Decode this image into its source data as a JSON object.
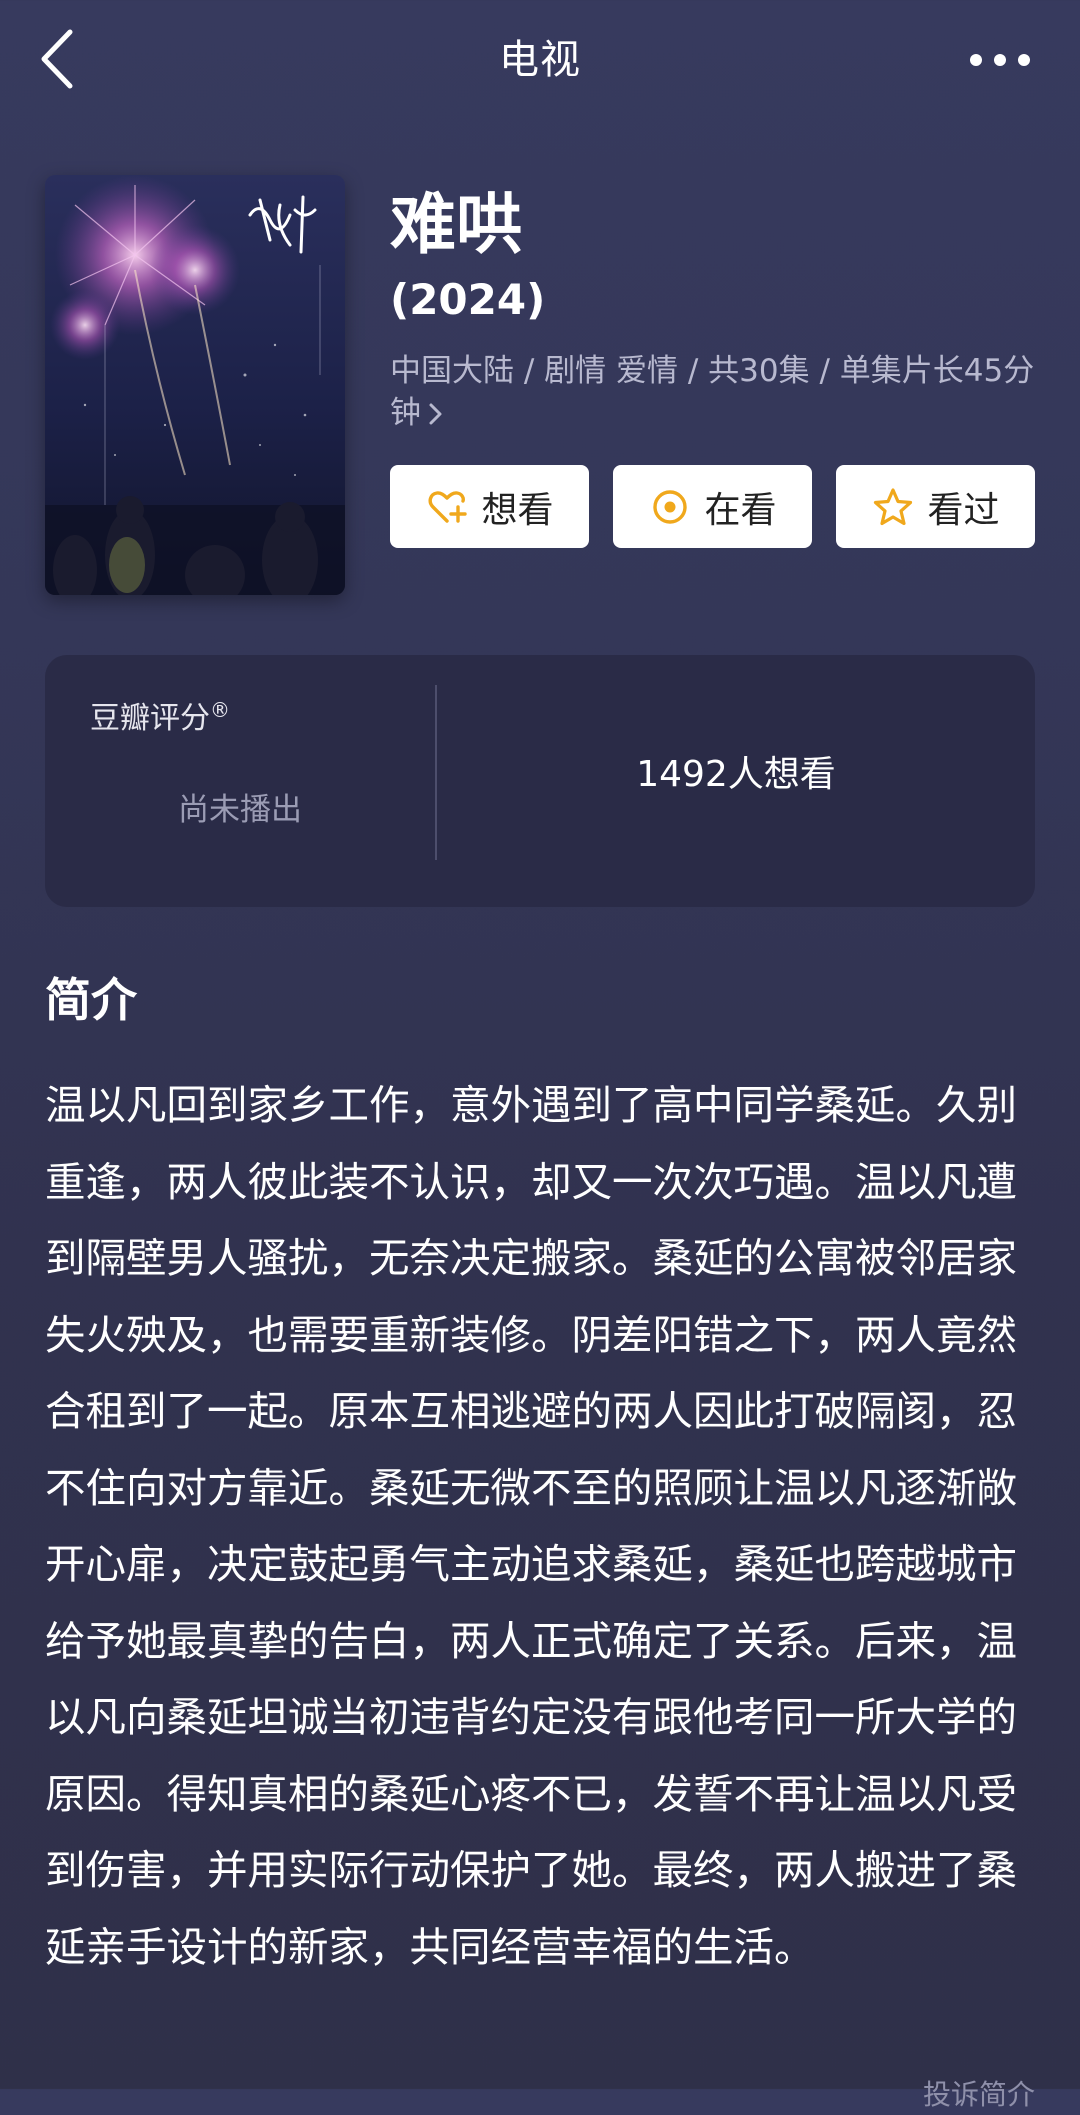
{
  "header": {
    "title": "电视",
    "back_icon": "chevron-left-icon",
    "more_icon": "more-horizontal-icon"
  },
  "movie": {
    "title": "难哄",
    "year": "(2024)",
    "meta": "中国大陆 / 剧情 爱情 / 共30集 / 单集片长45分钟",
    "poster_logo": "难哄"
  },
  "actions": {
    "want": {
      "label": "想看",
      "icon": "heart-plus-icon"
    },
    "watching": {
      "label": "在看",
      "icon": "circle-dot-icon"
    },
    "watched": {
      "label": "看过",
      "icon": "star-icon"
    }
  },
  "rating": {
    "label": "豆瓣评分",
    "trademark": "®",
    "status": "尚未播出",
    "want_count": "1492人想看"
  },
  "intro": {
    "heading": "简介",
    "body": "温以凡回到家乡工作，意外遇到了高中同学桑延。久别重逢，两人彼此装不认识，却又一次次巧遇。温以凡遭到隔壁男人骚扰，无奈决定搬家。桑延的公寓被邻居家失火殃及，也需要重新装修。阴差阳错之下，两人竟然合租到了一起。原本互相逃避的两人因此打破隔阂，忍不住向对方靠近。桑延无微不至的照顾让温以凡逐渐敞开心扉，决定鼓起勇气主动追求桑延，桑延也跨越城市给予她最真挚的告白，两人正式确定了关系。后来，温以凡向桑延坦诚当初违背约定没有跟他考同一所大学的原因。得知真相的桑延心疼不已，发誓不再让温以凡受到伤害，并用实际行动保护了她。最终，两人搬进了桑延亲手设计的新家，共同经营幸福的生活。",
    "report_link": "投诉简介"
  },
  "colors": {
    "background": "#353859",
    "card": "#2a2b47",
    "accent": "#f0a81c",
    "muted_text": "#b8b9cf"
  }
}
